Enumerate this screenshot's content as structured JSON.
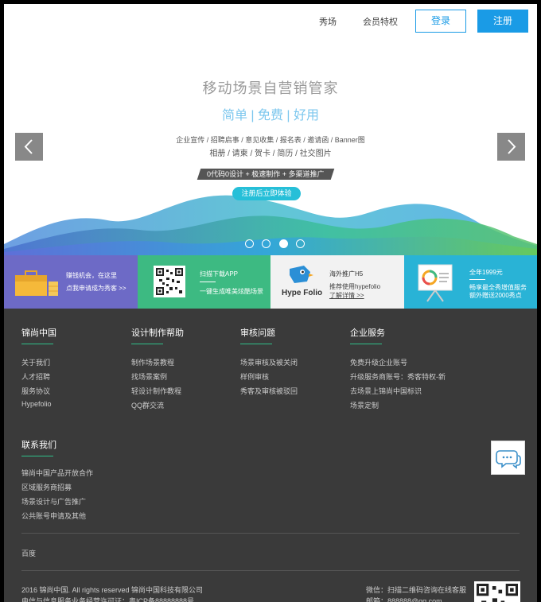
{
  "nav": {
    "links": [
      "秀场",
      "会员特权"
    ],
    "login": "登录",
    "register": "注册"
  },
  "hero": {
    "title": "移动场景自营销管家",
    "subtitle": "简单 | 免费 | 好用",
    "tags_line1": "企业宣传 / 招聘启事 / 意见收集 / 报名表 / 邀请函 / Banner图",
    "tags_line2": "相册 / 请柬 / 贺卡 / 简历 / 社交图片",
    "banner": "0代码0设计 + 极速制作 + 多渠道推广",
    "cta": "注册后立即体验",
    "arrow_left": "‹",
    "arrow_right": "›"
  },
  "promo": {
    "p1_line1": "赚钱机会，在这里",
    "p1_line2": "点我申请成为秀客 >>",
    "p2_line1": "扫描下载APP",
    "p2_line2": "一键生成唯美炫酷场景",
    "p3_logo": "Hype Folio",
    "p3_line1": "海外推广H5",
    "p3_line2": "推荐使用hypefolio",
    "p3_line3": "了解详情 >>",
    "p4_line1": "全年1999元",
    "p4_line2": "畅享最全秀增值服务",
    "p4_line3": "额外赠送2000秀点"
  },
  "footer": {
    "col1": {
      "title": "锦尚中国",
      "links": [
        "关于我们",
        "人才招聘",
        "服务协议",
        "Hypefolio"
      ]
    },
    "col2": {
      "title": "设计制作帮助",
      "links": [
        "制作场景教程",
        "找场景案例",
        "轻设计制作教程",
        "QQ群交流"
      ]
    },
    "col3": {
      "title": "审核问题",
      "links": [
        "场景审核及被关闭",
        "样例审核",
        "秀客及审核被驳回"
      ]
    },
    "col4": {
      "title": "企业服务",
      "links": [
        "免费升级企业账号",
        "升级服务商账号：秀客特权-新",
        "去场景上锦尚中国标识",
        "场景定制"
      ]
    },
    "contact": {
      "title": "联系我们",
      "links": [
        "锦尚中国产品开放合作",
        "区域服务商招募",
        "场景设计与广告推广",
        "公共账号申请及其他"
      ]
    },
    "friend_link": "百度",
    "copyright": "2016 锦尚中国. All rights reserved 锦尚中国科技有限公司",
    "icp": "电信与信息服务业务经营许可证：粤ICP备88888888号",
    "wechat": "微信：扫描二维码咨询在线客服",
    "email": "邮箱：888888@qq.com"
  },
  "colors": {
    "accent": "#1a9be6",
    "promo1": "#6d6ac6",
    "promo2": "#3dba82",
    "promo3": "#f2f2f2",
    "promo4": "#29b3d6",
    "footer_bg": "#3a3a3a"
  }
}
